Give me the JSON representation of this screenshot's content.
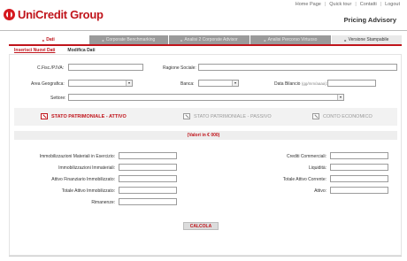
{
  "header": {
    "brand": "UniCredit Group",
    "app_title": "Pricing Advisory",
    "links": [
      "Home Page",
      "Quick tour",
      "Contatti",
      "Logout"
    ],
    "separator": "|"
  },
  "tabs": [
    {
      "label": "Dati",
      "active": true
    },
    {
      "label": "Corporate Benchmarking",
      "active": false
    },
    {
      "label": "Analisi 2 Corporate Advisor",
      "active": false
    },
    {
      "label": "Analisi Percorso Virtuoso",
      "active": false
    },
    {
      "label": "Versione Stampabile",
      "active": false
    }
  ],
  "subtabs": {
    "insert": "Inserisci Nuovi Dati",
    "edit": "Modifica Dati"
  },
  "form": {
    "cfpiva_label": "C.Fisc./P.IVA:",
    "ragione_label": "Ragione Sociale:",
    "area_label": "Area Geografica:",
    "banca_label": "Banca:",
    "data_label": "Data Bilancio",
    "data_hint": "(gg/mm/aaaa):",
    "settore_label": "Settore:"
  },
  "sections": {
    "attivo": "STATO PATRIMONIALE - ATTIVO",
    "passivo": "STATO PATRIMONIALE - PASSIVO",
    "conto": "CONTO ECONOMICO"
  },
  "values_note": "(Valori in € 000)",
  "left_fields": [
    "Immobilizzazioni Materiali in Esercizio:",
    "Immobilizzazioni Immateriali:",
    "Attivo Finanziario Immobilizzato:",
    "Totale Attivo Immobilizzato:",
    "Rimanenze:"
  ],
  "right_fields": [
    "Crediti Commerciali:",
    "Liquidità:",
    "Totale Attivo Corrente:",
    "Attivo:"
  ],
  "calc_button": "CALCOLA",
  "colors": {
    "brand_red": "#c0141b",
    "tab_gray": "#9a9a9a"
  }
}
